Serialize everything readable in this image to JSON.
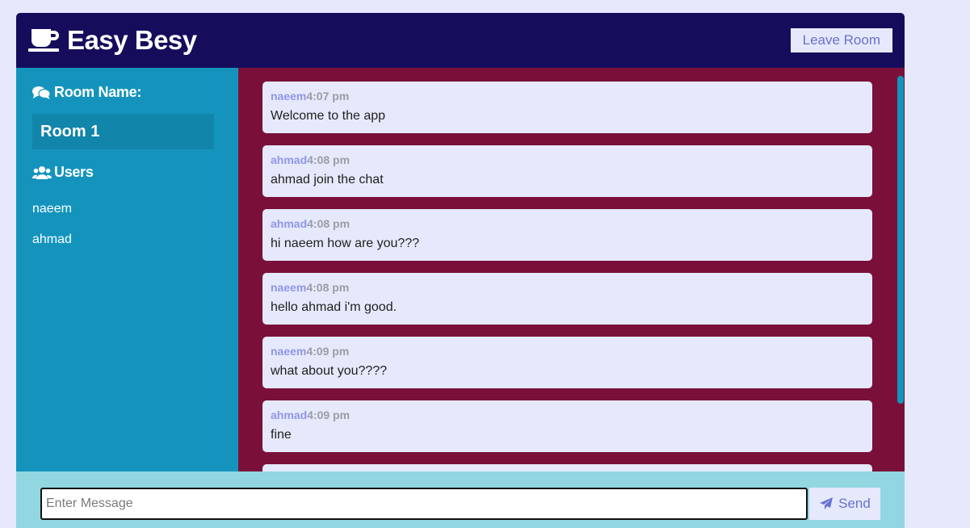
{
  "header": {
    "title": "Easy Besy",
    "leave_label": "Leave Room"
  },
  "sidebar": {
    "room_heading": "Room Name:",
    "room_name": "Room 1",
    "users_heading": "Users",
    "users": [
      "naeem",
      "ahmad"
    ]
  },
  "messages": [
    {
      "user": "naeem",
      "time": "4:07 pm",
      "text": "Welcome to the app"
    },
    {
      "user": "ahmad",
      "time": "4:08 pm",
      "text": "ahmad join the chat"
    },
    {
      "user": "ahmad",
      "time": "4:08 pm",
      "text": "hi naeem how are you???"
    },
    {
      "user": "naeem",
      "time": "4:08 pm",
      "text": "hello ahmad i'm good."
    },
    {
      "user": "naeem",
      "time": "4:09 pm",
      "text": "what about you????"
    },
    {
      "user": "ahmad",
      "time": "4:09 pm",
      "text": "fine"
    }
  ],
  "composer": {
    "placeholder": "Enter Message",
    "send_label": "Send"
  },
  "colors": {
    "header_bg": "#150d5b",
    "sidebar_bg": "#1494bd",
    "messages_bg": "#7a1039",
    "message_bg": "#e6e9fb",
    "composer_bg": "#91d6e1",
    "accent": "#6672d0"
  },
  "icons": {
    "brand": "coffee-cup-icon",
    "room": "comments-icon",
    "users": "users-icon",
    "send": "paper-plane-icon"
  }
}
